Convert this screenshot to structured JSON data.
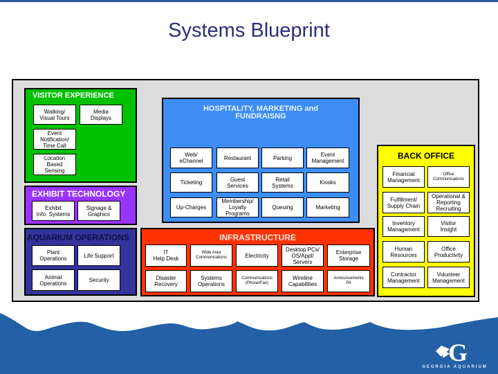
{
  "title": "Systems Blueprint",
  "colors": {
    "visitor_experience": "#00c000",
    "exhibit_technology": "#9933ff",
    "aquarium_operations": "#33339a",
    "hospitality": "#3d8df5",
    "infrastructure": "#ff3300",
    "back_office": "#ffff00",
    "wave": "#2360a5"
  },
  "panels": {
    "visitor_experience": {
      "title": "VISITOR EXPERIENCE",
      "items": [
        "Walking/\nVisual Tours",
        "Media\nDisplays",
        "Event\nNotification/\nTime Call",
        "Location\nBased\nSensing"
      ]
    },
    "exhibit_technology": {
      "title": "EXHIBIT TECHNOLOGY",
      "items": [
        "Exhibit\nInfo. Systems",
        "Signage &\nGraphics"
      ]
    },
    "aquarium_operations": {
      "title": "AQUARIUM OPERATIONS",
      "items": [
        "Plant\nOperations",
        "Life Support",
        "Animal\nOperations",
        "Security"
      ]
    },
    "hospitality": {
      "title": "HOSPITALITY, MARKETING and\nFUNDRAISNG",
      "items": [
        "Web/\neChannel",
        "Restaurant",
        "Parking",
        "Event\nManagement",
        "Ticketing",
        "Guest\nServices",
        "Retail\nSystems",
        "Kiosks",
        "Up-Charges",
        "Membership/\nLoyalty\nPrograms",
        "Queuing",
        "Marketing"
      ]
    },
    "infrastructure": {
      "title": "INFRASTRUCTURE",
      "items": [
        "IT\nHelp Desk",
        "Wide Area\nCommunications",
        "Electricity",
        "Desktop PCs/\nOS/Appl/\nServers",
        "Enterprise\nStorage",
        "Disaster\nRecovery",
        "Systems\nOperations",
        "Communications\n(Phone/Fax)",
        "Wireline\nCapabilities",
        "Announcements\nPA"
      ]
    },
    "back_office": {
      "title": "BACK OFFICE",
      "items": [
        "Financial\nManagement",
        "Office\nCommunications",
        "Fulfillment/\nSupply Chain",
        "Operational &\nReporting\nRecruiting",
        "Inventory\nManagement",
        "Visitor\nInsight",
        "Human\nResources",
        "Office\nProductivity",
        "Contractor\nManagement",
        "Volunteer\nManagement"
      ]
    }
  },
  "logo": {
    "mark": "G",
    "text": "GEORGIA AQUARIUM"
  }
}
